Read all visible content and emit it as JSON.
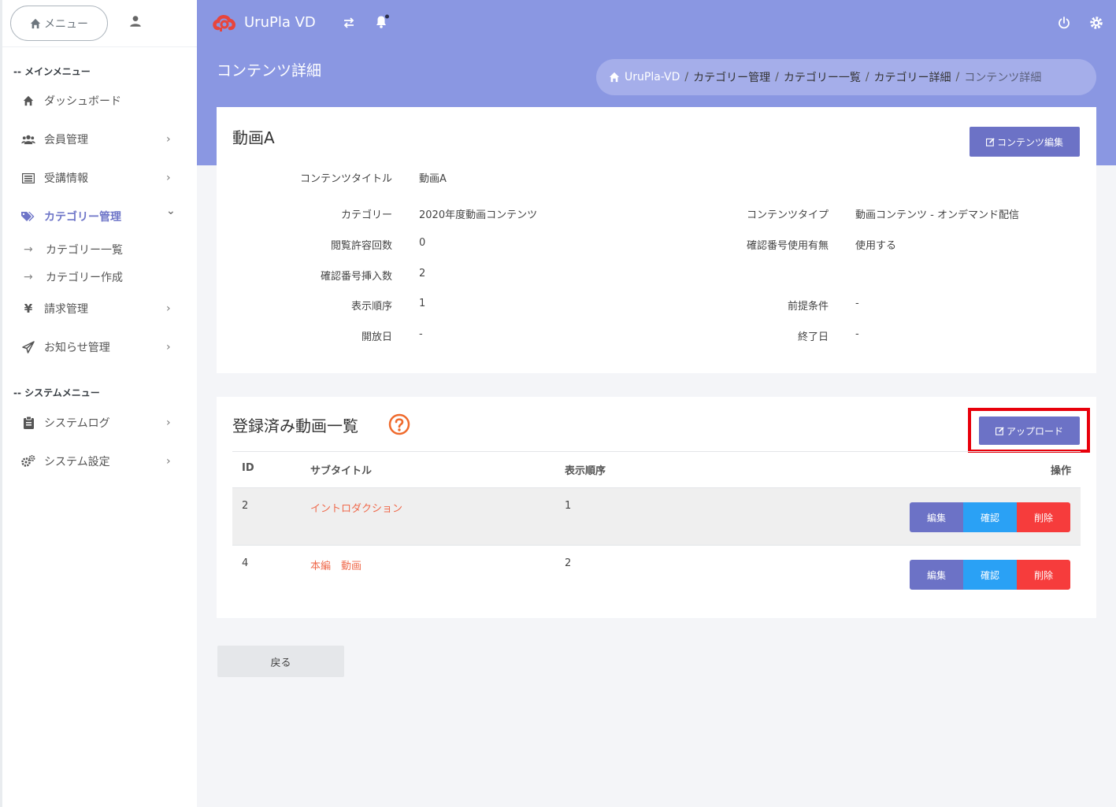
{
  "sidebar": {
    "menu_label": "メニュー",
    "main_heading": "-- メインメニュー",
    "system_heading": "-- システムメニュー",
    "items": [
      {
        "label": "ダッシュボード",
        "icon": "home-icon"
      },
      {
        "label": "会員管理",
        "icon": "users-icon"
      },
      {
        "label": "受講情報",
        "icon": "list-icon"
      },
      {
        "label": "カテゴリー管理",
        "icon": "tags-icon"
      },
      {
        "label": "請求管理",
        "icon": "yen-icon"
      },
      {
        "label": "お知らせ管理",
        "icon": "paper-plane-icon"
      },
      {
        "label": "システムログ",
        "icon": "clipboard-icon"
      },
      {
        "label": "システム設定",
        "icon": "gears-icon"
      }
    ],
    "sub_items": [
      {
        "label": "カテゴリー一覧"
      },
      {
        "label": "カテゴリー作成"
      }
    ],
    "yen_glyph": "¥",
    "arrow_glyph": "→",
    "chevron_right": "›",
    "chevron_down": "⌄"
  },
  "header": {
    "brand": "UruPla VD",
    "brand_color": "#e8453c",
    "bar_color": "#8a97e2"
  },
  "page": {
    "title": "コンテンツ詳細",
    "breadcrumb": [
      "UruPla-VD",
      "カテゴリー管理",
      "カテゴリー一覧",
      "カテゴリー詳細",
      "コンテンツ詳細"
    ],
    "breadcrumb_sep": "/"
  },
  "detail": {
    "title": "動画A",
    "edit_button": "コンテンツ編集",
    "fields": {
      "content_title": {
        "label": "コンテンツタイトル",
        "value": "動画A"
      },
      "category": {
        "label": "カテゴリー",
        "value": "2020年度動画コンテンツ"
      },
      "content_type": {
        "label": "コンテンツタイプ",
        "value": "動画コンテンツ - オンデマンド配信"
      },
      "view_limit": {
        "label": "閲覧許容回数",
        "value": "0"
      },
      "confirm_use": {
        "label": "確認番号使用有無",
        "value": "使用する"
      },
      "confirm_count": {
        "label": "確認番号挿入数",
        "value": "2"
      },
      "display_order": {
        "label": "表示順序",
        "value": "1"
      },
      "prerequisite": {
        "label": "前提条件",
        "value": "-"
      },
      "open_date": {
        "label": "開放日",
        "value": "-"
      },
      "end_date": {
        "label": "終了日",
        "value": "-"
      }
    }
  },
  "videos": {
    "title": "登録済み動画一覧",
    "upload_button": "アップロード",
    "columns": {
      "id": "ID",
      "subtitle": "サブタイトル",
      "order": "表示順序",
      "actions": "操作"
    },
    "rows": [
      {
        "id": "2",
        "subtitle": "イントロダクション",
        "order": "1"
      },
      {
        "id": "4",
        "subtitle": "本編　動画",
        "order": "2"
      }
    ],
    "actions": {
      "edit": "編集",
      "check": "確認",
      "delete": "削除"
    }
  },
  "back_button": "戻る"
}
